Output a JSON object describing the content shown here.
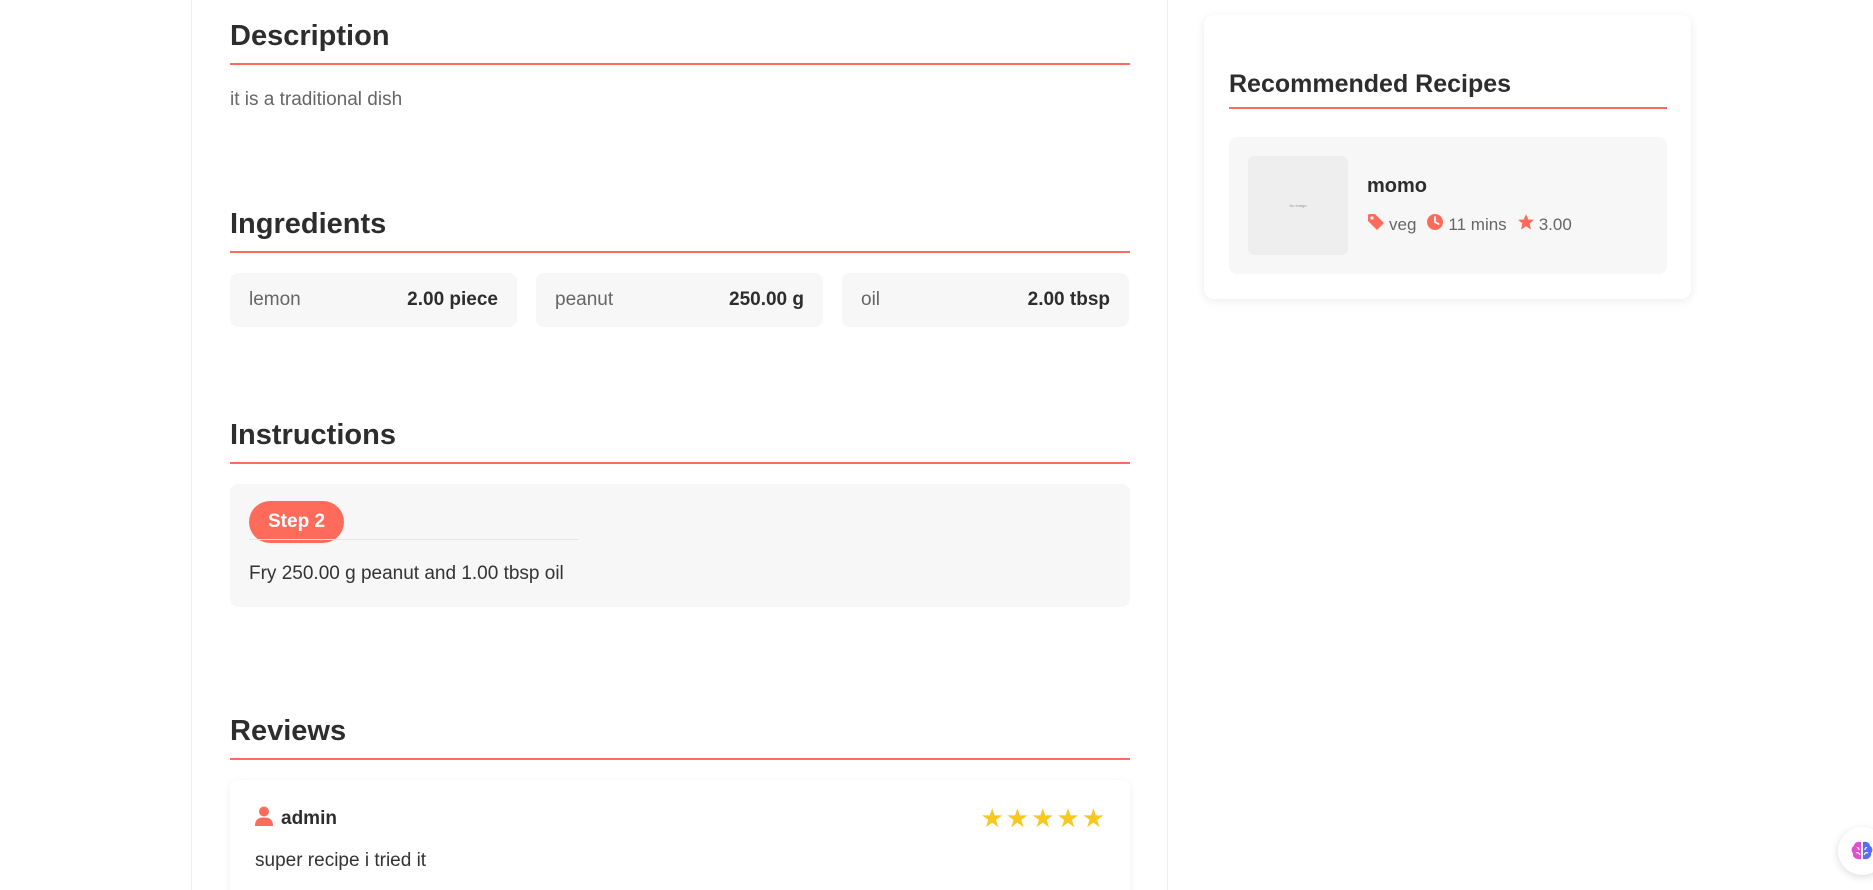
{
  "description": {
    "title": "Description",
    "text": "it is a traditional dish"
  },
  "ingredients": {
    "title": "Ingredients",
    "items": [
      {
        "name": "lemon",
        "quantity": "2.00 piece"
      },
      {
        "name": "peanut",
        "quantity": "250.00 g"
      },
      {
        "name": "oil",
        "quantity": "2.00 tbsp"
      }
    ]
  },
  "instructions": {
    "title": "Instructions",
    "steps": [
      {
        "badge": "Step 2",
        "text": "Fry 250.00 g peanut and 1.00 tbsp oil"
      }
    ]
  },
  "reviews": {
    "title": "Reviews",
    "items": [
      {
        "user": "admin",
        "rating": 5,
        "text": "super recipe i tried it"
      }
    ]
  },
  "sidebar": {
    "title": "Recommended Recipes",
    "recipes": [
      {
        "name": "momo",
        "category": "veg",
        "time": "11 mins",
        "rating": "3.00",
        "thumb_alt": "No image"
      }
    ]
  },
  "colors": {
    "accent": "#ff6b5b",
    "star": "#f7c81d",
    "card_bg": "#f7f7f7"
  },
  "icons": [
    "tag-icon",
    "clock-icon",
    "star-icon",
    "user-icon",
    "brain-icon"
  ]
}
